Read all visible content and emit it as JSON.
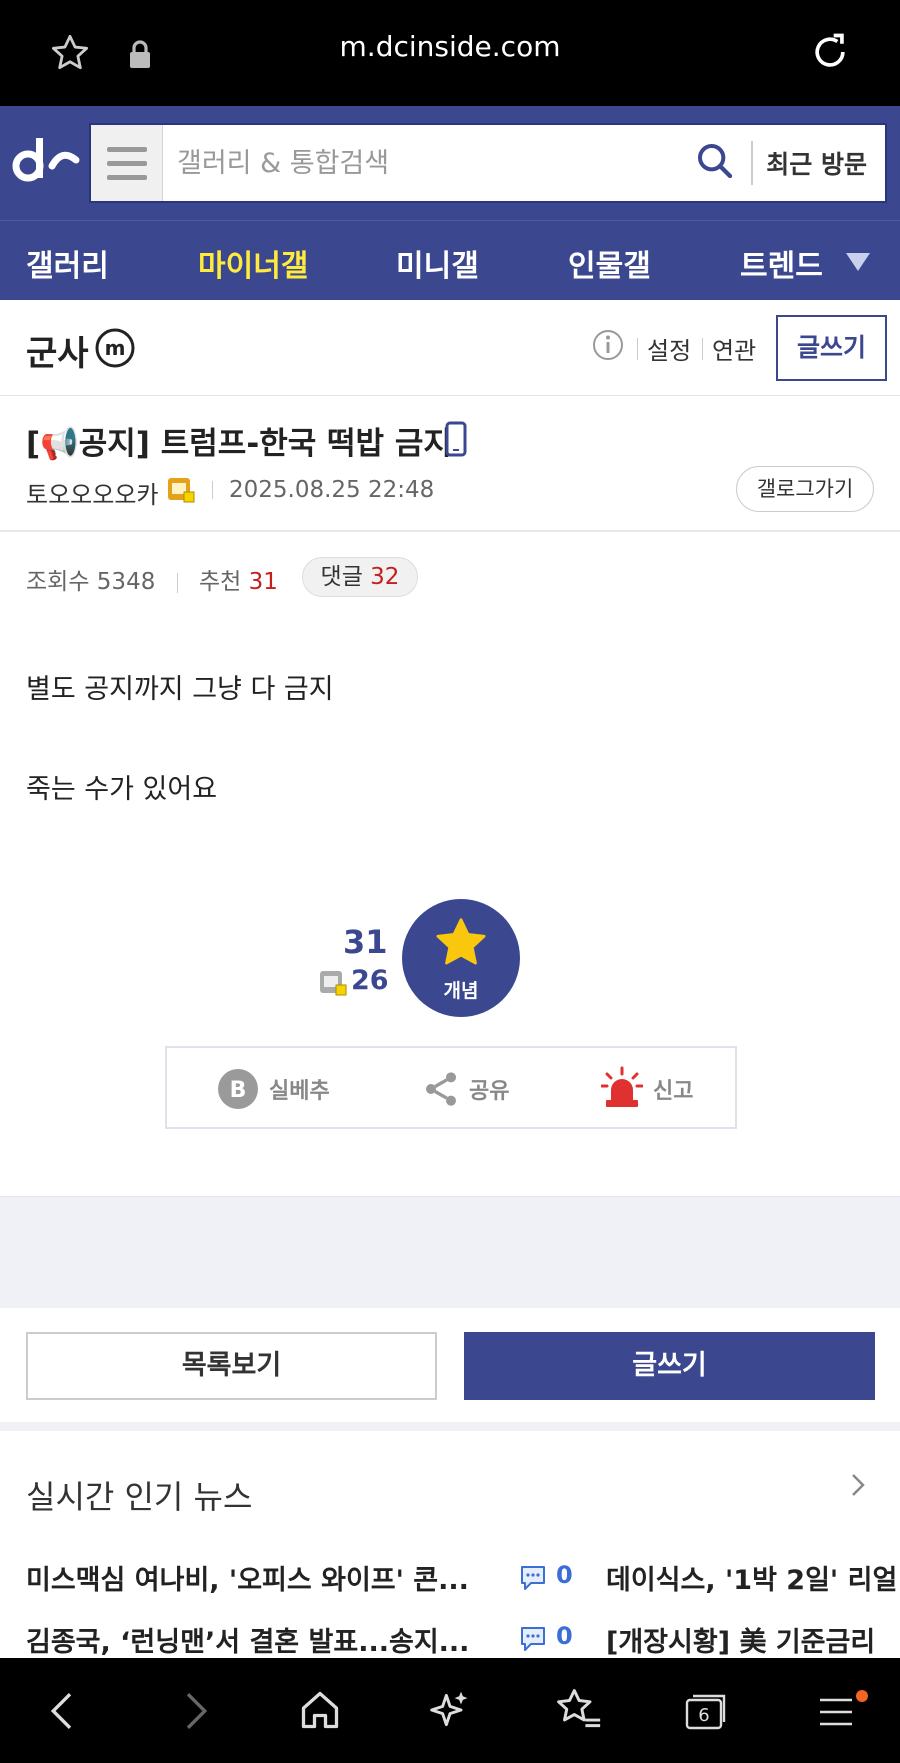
{
  "browser": {
    "url": "m.dcinside.com"
  },
  "header": {
    "search_placeholder": "갤러리 & 통합검색",
    "recent_label": "최근 방문"
  },
  "nav": {
    "items": [
      "갤러리",
      "마이너갤",
      "미니갤",
      "인물갤",
      "트렌드"
    ]
  },
  "gallery": {
    "title": "군사",
    "settings_label": "설정",
    "related_label": "연관",
    "write_label": "글쓰기"
  },
  "post": {
    "title": "[📢공지] 트럼프-한국 떡밥 금지",
    "author": "토오오오오카",
    "date": "2025.08.25 22:48",
    "gallog_label": "갤로그가기",
    "views_label": "조회수",
    "views": "5348",
    "recommend_label": "추천",
    "recommend": "31",
    "comments_label": "댓글",
    "comments": "32",
    "body": [
      "별도 공지까지 그냥 다 금지",
      "죽는 수가 있어요"
    ]
  },
  "recommend_box": {
    "up_count": "31",
    "fixed_count": "26",
    "button_label": "개념",
    "actions": [
      "실베추",
      "공유",
      "신고"
    ]
  },
  "buttons": {
    "list_label": "목록보기",
    "write_label": "글쓰기"
  },
  "news": {
    "title": "실시간 인기 뉴스",
    "rows": [
      {
        "left": "미스맥심 여나비, '오피스 와이프' 콘...",
        "count": "0",
        "right": "데이식스, '1박 2일' 리얼"
      },
      {
        "left": "김종국, ‘런닝맨’서 결혼 발표...송지...",
        "count": "0",
        "right": "[개장시황] 美 기준금리"
      }
    ]
  },
  "bottom_nav": {
    "tab_count": "6"
  },
  "colors": {
    "brand": "#3b4890",
    "accent_yellow": "#ffeb3b",
    "red": "#c61d1d",
    "star": "#f9c80e"
  }
}
